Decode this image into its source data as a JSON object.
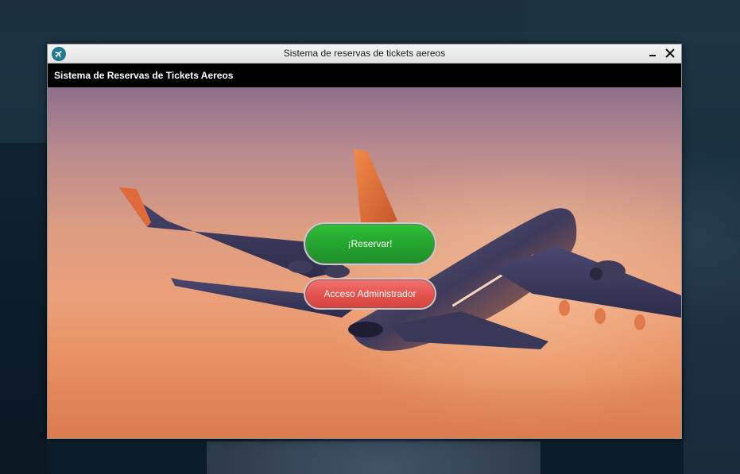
{
  "window": {
    "title": "Sistema de reservas de tickets aereos",
    "icon": "airplane-icon",
    "controls": [
      "minimize-icon",
      "close-icon"
    ]
  },
  "header": {
    "title": "Sistema de Reservas de Tickets Aereos"
  },
  "main": {
    "background": "airplane-sunset-photo",
    "reservar_label": "¡Reservar!",
    "admin_label": "Acceso Administrador"
  },
  "colors": {
    "header_bg": "#000000",
    "reservar_green": "#25a52f",
    "admin_red": "#e4524e",
    "app_icon_teal": "#1f7a8c"
  }
}
